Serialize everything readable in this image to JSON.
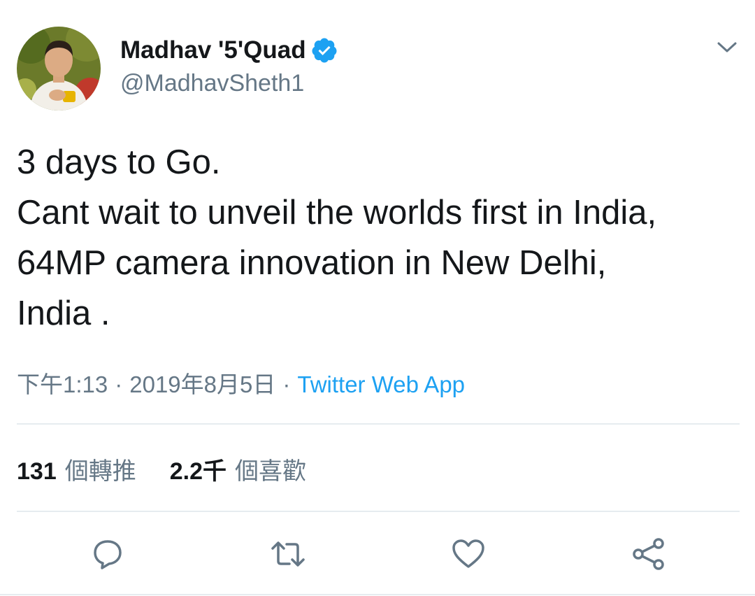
{
  "author": {
    "display_name": "Madhav '5'Quad",
    "handle": "@MadhavSheth1",
    "verified": true
  },
  "tweet": {
    "lines": [
      "3 days to Go.",
      "Cant wait to unveil the worlds first in India,",
      "64MP camera innovation in New Delhi,",
      "India ."
    ]
  },
  "meta": {
    "time": "下午1:13",
    "separator": "·",
    "date": "2019年8月5日",
    "source": "Twitter Web App"
  },
  "stats": {
    "retweet_count": "131",
    "retweet_label": "個轉推",
    "like_count": "2.2千",
    "like_label": "個喜歡"
  },
  "actions": [
    {
      "name": "reply",
      "icon": "reply-icon"
    },
    {
      "name": "retweet",
      "icon": "retweet-icon"
    },
    {
      "name": "like",
      "icon": "heart-icon"
    },
    {
      "name": "share",
      "icon": "share-icon"
    }
  ],
  "colors": {
    "text": "#14171a",
    "secondary": "#657786",
    "accent": "#1da1f2",
    "divider": "#e6ecf0"
  }
}
